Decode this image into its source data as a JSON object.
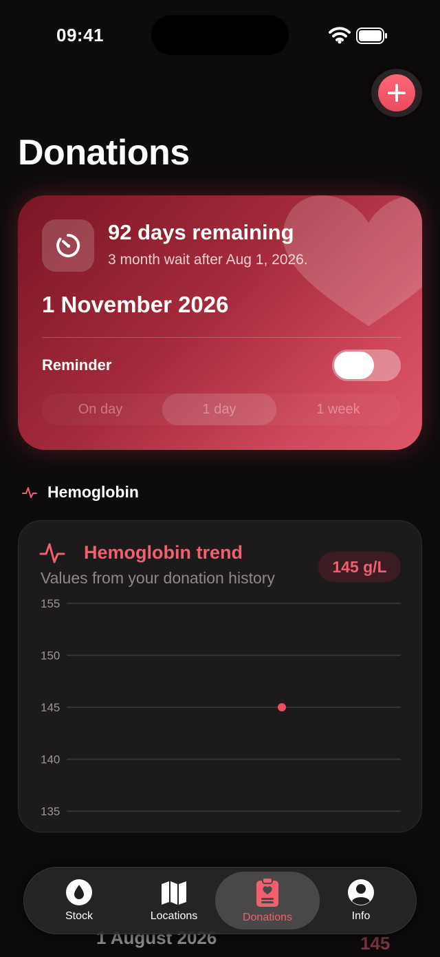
{
  "status": {
    "time": "09:41"
  },
  "page": {
    "title": "Donations"
  },
  "card": {
    "days_remaining": "92 days remaining",
    "wait_text": "3 month wait after Aug 1, 2026.",
    "next_date": "1 November 2026",
    "reminder_label": "Reminder",
    "reminder_on": true,
    "segments": [
      "On day",
      "1 day",
      "1 week"
    ],
    "selected_segment": "1 day"
  },
  "hemoglobin": {
    "section_title": "Hemoglobin",
    "card_title": "Hemoglobin trend",
    "card_subtitle": "Values from your donation history",
    "current_value": "145 g/L"
  },
  "chart_data": {
    "type": "scatter",
    "title": "Hemoglobin trend",
    "subtitle": "Values from your donation history",
    "ylim": [
      135,
      155
    ],
    "y_ticks": [
      "155",
      "150",
      "145",
      "140",
      "135"
    ],
    "points": [
      {
        "y": 145
      }
    ],
    "grid": true,
    "color": "#e8515f"
  },
  "peek": {
    "date": "1 August 2026",
    "value": "145"
  },
  "tabs": [
    {
      "label": "Stock",
      "icon": "drop-icon"
    },
    {
      "label": "Locations",
      "icon": "map-icon"
    },
    {
      "label": "Donations",
      "icon": "clipboard-heart-icon"
    },
    {
      "label": "Info",
      "icon": "person-circle-icon"
    }
  ],
  "selected_tab": "Donations",
  "colors": {
    "accent": "#f0606f",
    "background": "#0d0b0c",
    "card": "#1c1a1b"
  }
}
